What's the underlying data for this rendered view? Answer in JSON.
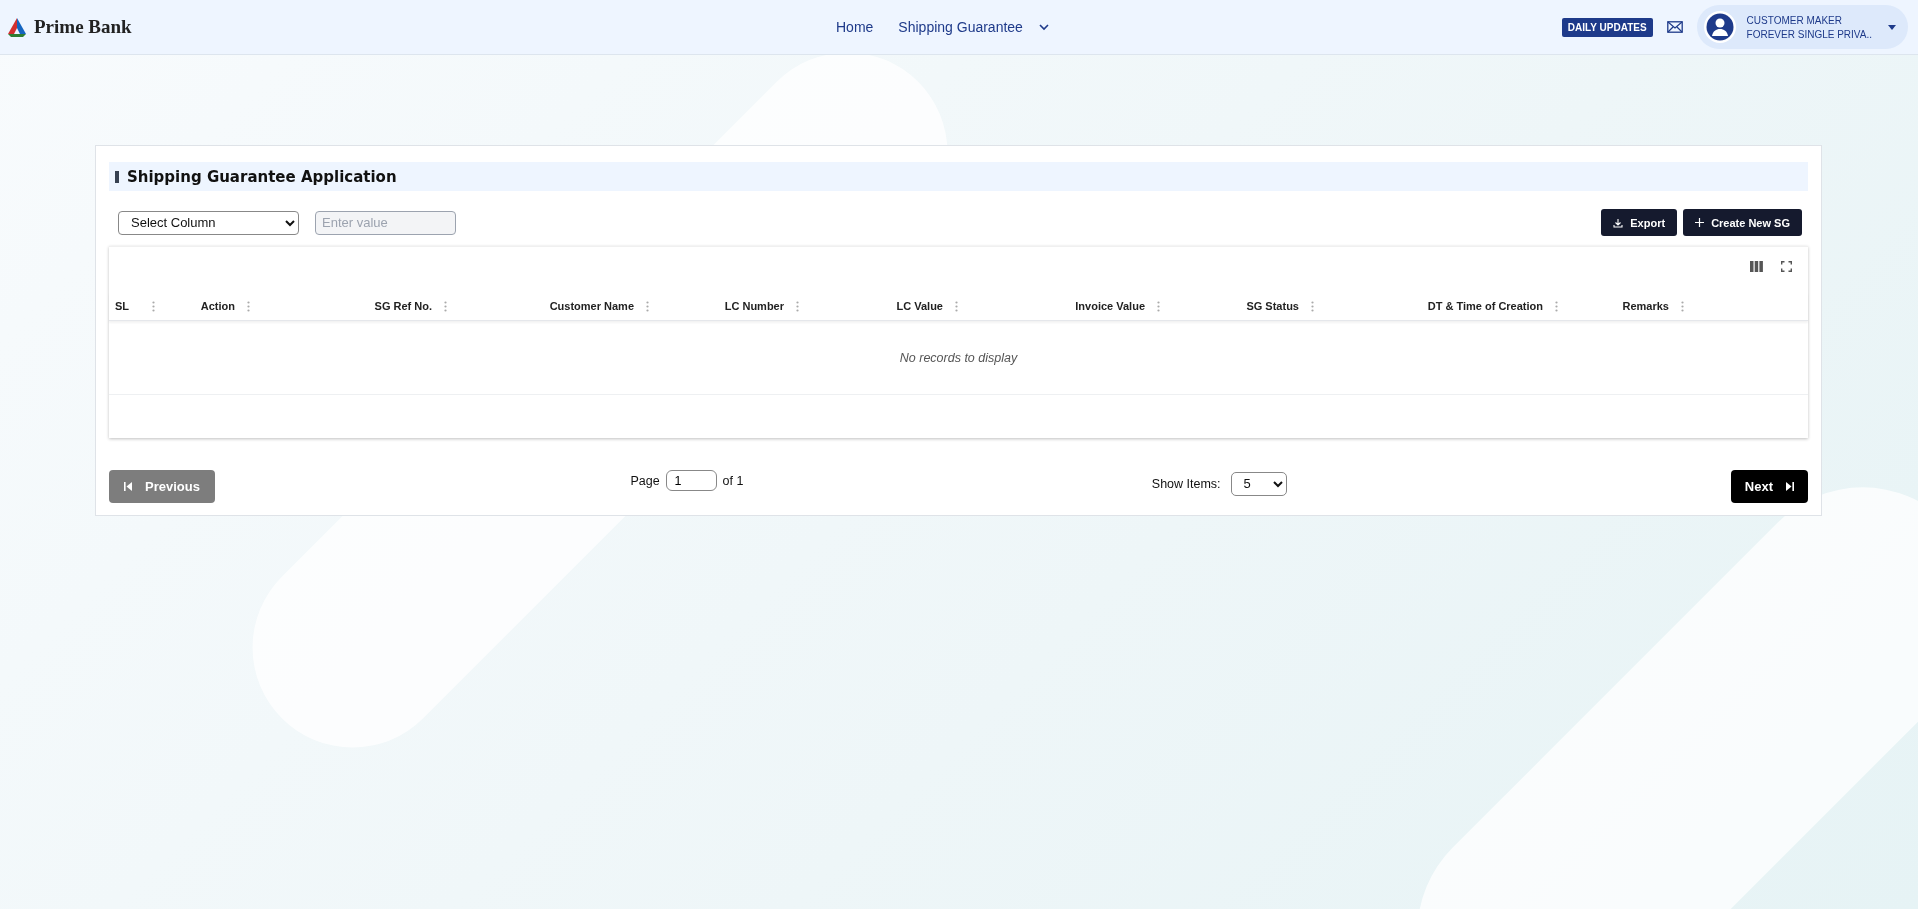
{
  "header": {
    "brand": "Prime Bank",
    "nav": [
      {
        "label": "Home",
        "dropdown": false
      },
      {
        "label": "Shipping Guarantee",
        "dropdown": true
      }
    ],
    "badge": "DAILY UPDATES",
    "user": {
      "name": "CUSTOMER MAKER",
      "role": "FOREVER SINGLE PRIVA.."
    }
  },
  "panel": {
    "title": "Shipping Guarantee Application",
    "filter": {
      "column": "Select Column",
      "value_placeholder": "Enter value"
    },
    "buttons": [
      {
        "label": "Export",
        "kind": "export"
      },
      {
        "label": "Create New SG",
        "kind": "create"
      }
    ],
    "table": {
      "columns": [
        {
          "label": "SL"
        },
        {
          "label": "Action"
        },
        {
          "label": "SG Ref No."
        },
        {
          "label": "Customer Name"
        },
        {
          "label": "LC Number"
        },
        {
          "label": "LC Value"
        },
        {
          "label": "Invoice Value"
        },
        {
          "label": "SG Status"
        },
        {
          "label": "DT & Time of Creation"
        },
        {
          "label": "Remarks"
        }
      ],
      "empty_message": "No records to display"
    },
    "pagination": {
      "previous": {
        "label": "Previous",
        "disabled": true
      },
      "page_label": "Page",
      "page": "1",
      "of_label": "of 1",
      "show_items_label": "Show Items:",
      "show_items": "5",
      "next": {
        "label": "Next",
        "disabled": false
      }
    }
  }
}
